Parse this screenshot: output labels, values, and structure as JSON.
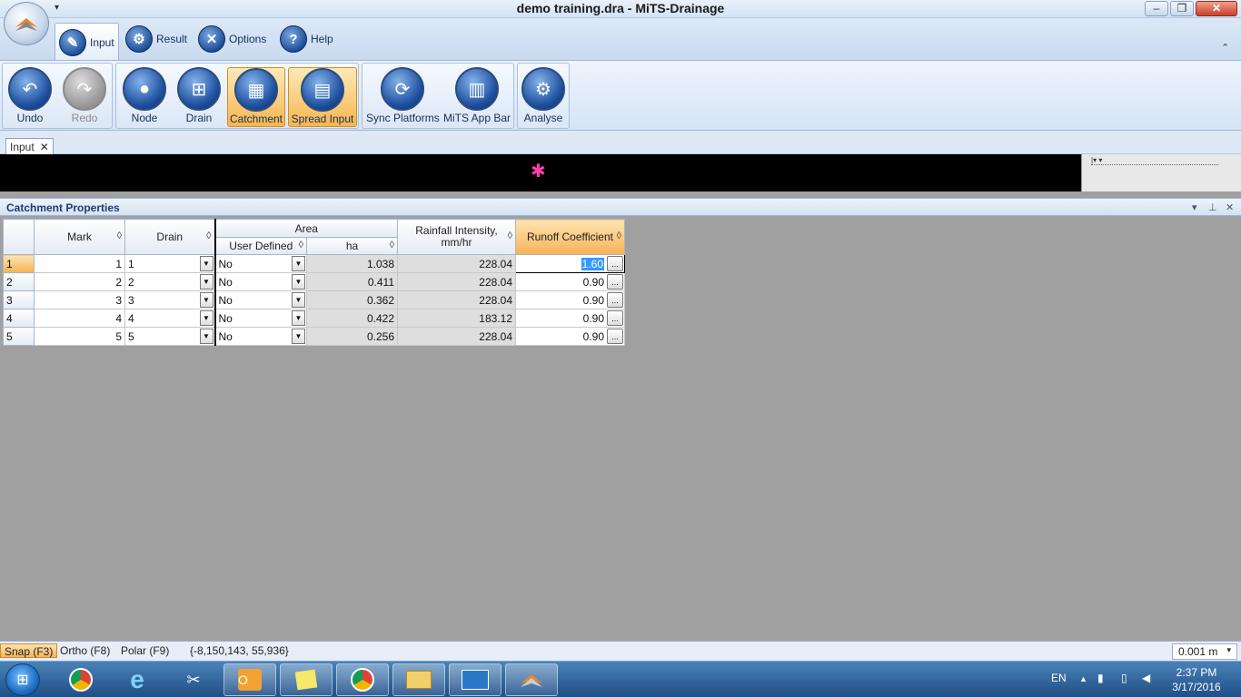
{
  "window": {
    "title": "demo training.dra - MiTS-Drainage",
    "qat_glyph": "▾",
    "min_glyph": "–",
    "max_glyph": "❐",
    "close_glyph": "✕"
  },
  "ribbon_tabs": [
    {
      "label": "Input",
      "icon": "input-icon"
    },
    {
      "label": "Result",
      "icon": "gear-icon"
    },
    {
      "label": "Options",
      "icon": "tools-icon"
    },
    {
      "label": "Help",
      "icon": "help-icon"
    }
  ],
  "collapse_glyph": "⌃",
  "ribbon": {
    "undo": "Undo",
    "redo": "Redo",
    "node": "Node",
    "drain": "Drain",
    "catchment": "Catchment",
    "spread_input": "Spread Input",
    "sync_platforms": "Sync Platforms",
    "mits_app_bar": "MiTS App Bar",
    "analyse": "Analyse"
  },
  "doc_tab": {
    "label": "Input",
    "close": "✕"
  },
  "canvas_side": {
    "dropdown": "|▾ ▾"
  },
  "panel": {
    "title": "Catchment Properties",
    "pin_glyph": "⊥",
    "close_glyph": "✕",
    "menu_glyph": "▾"
  },
  "grid": {
    "headers": {
      "mark": "Mark",
      "drain": "Drain",
      "area": "Area",
      "user_defined": "User Defined",
      "ha": "ha",
      "rainfall": "Rainfall Intensity, mm/hr",
      "runoff": "Runoff Coefficient"
    },
    "sort_glyph": "◊",
    "rows": [
      {
        "num": "1",
        "mark": "1",
        "drain": "1",
        "user_defined": "No",
        "ha": "1.038",
        "rainfall": "228.04",
        "runoff": "1.60"
      },
      {
        "num": "2",
        "mark": "2",
        "drain": "2",
        "user_defined": "No",
        "ha": "0.411",
        "rainfall": "228.04",
        "runoff": "0.90"
      },
      {
        "num": "3",
        "mark": "3",
        "drain": "3",
        "user_defined": "No",
        "ha": "0.362",
        "rainfall": "228.04",
        "runoff": "0.90"
      },
      {
        "num": "4",
        "mark": "4",
        "drain": "4",
        "user_defined": "No",
        "ha": "0.422",
        "rainfall": "183.12",
        "runoff": "0.90"
      },
      {
        "num": "5",
        "mark": "5",
        "drain": "5",
        "user_defined": "No",
        "ha": "0.256",
        "rainfall": "228.04",
        "runoff": "0.90"
      }
    ]
  },
  "statusbar": {
    "snap": "Snap (F3)",
    "ortho": "Ortho (F8)",
    "polar": "Polar (F9)",
    "coords": "{-8,150,143, 55,936}",
    "units": "0.001 m",
    "units_arrow": "▾"
  },
  "taskbar": {
    "language": "EN",
    "time": "2:37 PM",
    "date": "3/17/2016"
  },
  "colors": {
    "accent": "#f7b357",
    "ribbon": "#dce8f6",
    "taskbar": "#1f4f85"
  }
}
